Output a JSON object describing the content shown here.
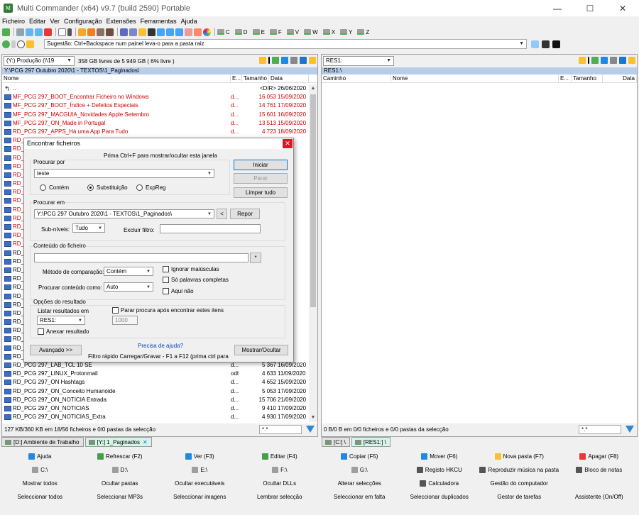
{
  "window": {
    "title": "Multi Commander (x64)  v9.7 (build 2590) Portable",
    "min": "—",
    "max": "☐",
    "close": "✕"
  },
  "menu": [
    "Ficheiro",
    "Editar",
    "Ver",
    "Configuração",
    "Extensões",
    "Ferramentas",
    "Ajuda"
  ],
  "drives": [
    "C",
    "D",
    "E",
    "F",
    "V",
    "W",
    "X",
    "Y",
    "Z"
  ],
  "cmdline": {
    "placeholder": "Sugestão: Ctrl+Backspace num painel leva-o para a pasta raiz"
  },
  "left": {
    "drive": "(Y:) Produção (\\\\19",
    "free": "358 GB livres de 5 949 GB ( 6% livre )",
    "path": "Y:\\PCG 297 Outubro 2020\\1 - TEXTOS\\1_Paginados\\",
    "cols": [
      "Nome",
      "E...",
      "Tamanho",
      "Data"
    ],
    "rows": [
      {
        "n": "..",
        "e": "",
        "s": "<DIR>",
        "d": "26/06/2020",
        "red": false,
        "up": true
      },
      {
        "n": "MF_PCG 297_BOOT_Encontrar Ficheiro no Windows",
        "e": "d...",
        "s": "16 053",
        "d": "15/09/2020",
        "red": true
      },
      {
        "n": "MF_PCG 297_BOOT_Índice + Defeitos Especiais",
        "e": "d...",
        "s": "14 761",
        "d": "17/09/2020",
        "red": true
      },
      {
        "n": "MF_PCG 297_MACGUIA_Novidades Apple Setembro",
        "e": "d...",
        "s": "15 601",
        "d": "16/09/2020",
        "red": true
      },
      {
        "n": "MF_PCG 297_ON_Made in Portugal",
        "e": "d...",
        "s": "13 513",
        "d": "15/09/2020",
        "red": true
      },
      {
        "n": "RD_PCG 297_APPS_Há uma App Para Tudo",
        "e": "d...",
        "s": "4 723",
        "d": "18/09/2020",
        "red": true
      },
      {
        "n": "RD_",
        "e": "",
        "s": "",
        "d": "20...",
        "red": true
      },
      {
        "n": "RD_",
        "e": "",
        "s": "",
        "d": "20...",
        "red": true
      },
      {
        "n": "RD_",
        "e": "",
        "s": "",
        "d": "20...",
        "red": true
      },
      {
        "n": "RD_",
        "e": "",
        "s": "",
        "d": "20...",
        "red": true
      },
      {
        "n": "RD_",
        "e": "",
        "s": "",
        "d": "20...",
        "red": true
      },
      {
        "n": "RD_",
        "e": "",
        "s": "",
        "d": "20...",
        "red": true
      },
      {
        "n": "RD_",
        "e": "",
        "s": "",
        "d": "20...",
        "red": true
      },
      {
        "n": "RD_",
        "e": "",
        "s": "",
        "d": "20...",
        "red": true
      },
      {
        "n": "RD_",
        "e": "",
        "s": "",
        "d": "20...",
        "red": true
      },
      {
        "n": "RD_",
        "e": "",
        "s": "",
        "d": "20...",
        "red": true
      },
      {
        "n": "RD_",
        "e": "",
        "s": "",
        "d": "20...",
        "red": true
      },
      {
        "n": "RD_",
        "e": "",
        "s": "",
        "d": "20...",
        "red": true
      },
      {
        "n": "RD_",
        "e": "",
        "s": "",
        "d": "20...",
        "red": true
      },
      {
        "n": "RD_",
        "e": "",
        "s": "",
        "d": "20...",
        "red": false
      },
      {
        "n": "RD_",
        "e": "",
        "s": "",
        "d": "20...",
        "red": false
      },
      {
        "n": "RD_",
        "e": "",
        "s": "",
        "d": "20...",
        "red": false
      },
      {
        "n": "RD_",
        "e": "",
        "s": "",
        "d": "20...",
        "red": false
      },
      {
        "n": "RD_",
        "e": "",
        "s": "",
        "d": "20...",
        "red": false
      },
      {
        "n": "RD_",
        "e": "",
        "s": "",
        "d": "20...",
        "red": false
      },
      {
        "n": "RD_",
        "e": "",
        "s": "",
        "d": "20...",
        "red": false
      },
      {
        "n": "RD_",
        "e": "",
        "s": "",
        "d": "20...",
        "red": false
      },
      {
        "n": "RD_",
        "e": "",
        "s": "",
        "d": "20...",
        "red": false
      },
      {
        "n": "RD_",
        "e": "",
        "s": "",
        "d": "20...",
        "red": false
      },
      {
        "n": "RD_",
        "e": "",
        "s": "",
        "d": "20...",
        "red": false
      },
      {
        "n": "RD_",
        "e": "",
        "s": "",
        "d": "20...",
        "red": false
      },
      {
        "n": "RD_",
        "e": "",
        "s": "",
        "d": "20...",
        "red": false
      },
      {
        "n": "RD_PCG 297_LAB_TCL 10 SE",
        "e": "d...",
        "s": "5 367",
        "d": "16/09/2020",
        "red": false
      },
      {
        "n": "RD_PCG 297_LINUX_Protonmail",
        "e": "odt",
        "s": "4 633",
        "d": "11/09/2020",
        "red": false
      },
      {
        "n": "RD_PCG 297_ON Hashtags",
        "e": "d...",
        "s": "4 652",
        "d": "15/09/2020",
        "red": false
      },
      {
        "n": "RD_PCG 297_ON_Conceito Humanoide",
        "e": "d...",
        "s": "5 053",
        "d": "17/09/2020",
        "red": false
      },
      {
        "n": "RD_PCG 297_ON_NOTICIA Entrada",
        "e": "d...",
        "s": "15 706",
        "d": "21/09/2020",
        "red": false
      },
      {
        "n": "RD_PCG 297_ON_NOTICIAS",
        "e": "d...",
        "s": "9 410",
        "d": "17/09/2020",
        "red": false
      },
      {
        "n": "RD_PCG 297_ON_NOTICIAS_Extra",
        "e": "d...",
        "s": "4 930",
        "d": "17/09/2020",
        "red": false
      }
    ],
    "status": "127 KB/360 KB em 18/56 ficheiros e 0/0 pastas da selecção",
    "filter": "*.*"
  },
  "right": {
    "drive": "RES1:",
    "path": "RES1:\\",
    "cols": [
      "Caminho",
      "Nome",
      "E...",
      "Tamanho",
      "Data"
    ],
    "status": "0 B/0 B em 0/0 ficheiros e 0/0 pastas da selecção",
    "filter": "*.*"
  },
  "tabs_left": [
    {
      "label": "[D:] Ambiente de Trabalho",
      "active": false
    },
    {
      "label": "[Y:] 1_Paginados",
      "active": true,
      "x": "✕"
    }
  ],
  "tabs_right": [
    {
      "label": "[C:] \\",
      "active": false
    },
    {
      "label": "[RES1:] \\",
      "active": true
    }
  ],
  "buttons": [
    [
      "Ajuda",
      "Refrescar (F2)",
      "Ver (F3)",
      "Editar (F4)",
      "Copiar (F5)",
      "Mover (F6)",
      "Nova pasta (F7)",
      "Apagar (F8)"
    ],
    [
      "C:\\",
      "D:\\",
      "E:\\",
      "F:\\",
      "G:\\",
      "Registo HKCU",
      "Reproduzir música na pasta",
      "Bloco de notas"
    ],
    [
      "Mostrar todos",
      "Ocultar pastas",
      "Ocultar executáveis",
      "Ocultar DLLs",
      "Alterar selecções",
      "Calculadora",
      "Gestão do computador",
      ""
    ],
    [
      "Seleccionar todos",
      "Seleccionar MP3s",
      "Seleccionar imagens",
      "Lembrar selecção",
      "Seleccionar em falta",
      "Seleccionar duplicados",
      "Gestor de tarefas",
      "Assistente (On/Off)"
    ]
  ],
  "dialog": {
    "title": "Encontrar ficheiros",
    "close": "✕",
    "hint": "Prima Ctrl+F para mostrar/ocultar esta janela",
    "search_for_label": "Procurar por",
    "search_for_value": "teste",
    "radio_contains": "Contém",
    "radio_subst": "Substituição",
    "radio_regex": "ExpReg",
    "start": "Iniciar",
    "stop": "Parar",
    "clear": "Limpar tudo",
    "search_in_label": "Procurar em",
    "search_in_value": "Y:\\PCG 297 Outubro 2020\\1 - TEXTOS\\1_Paginados\\",
    "lt": "<",
    "reset": "Repor",
    "sublevels_label": "Sub-níveis:",
    "sublevels_value": "Tudo",
    "exclude_label": "Excluir filtro:",
    "content_label": "Conteúdo do ficheiro",
    "star": "*",
    "cmp_label": "Método de comparação:",
    "cmp_value": "Contém",
    "search_as_label": "Procurar conteúdo como:",
    "search_as_value": "Auto",
    "chk_ignore": "Ignorar maiúsculas",
    "chk_whole": "Só palavras completas",
    "chk_here": "Aqui não",
    "results_label": "Opções do resultado",
    "list_in_label": "Listar resultados em",
    "list_in_value": "RES1:",
    "chk_stop": "Parar procura após encontrar estes itens",
    "stop_count": "1000",
    "chk_append": "Anexar resultado",
    "help": "Precisa de ajuda?",
    "advanced": "Avançado >>",
    "quick_filter": "Filtro rápido Carregar/Gravar - F1 a F12 (prima ctrl para",
    "show_hide": "Mostrar/Ocultar"
  }
}
